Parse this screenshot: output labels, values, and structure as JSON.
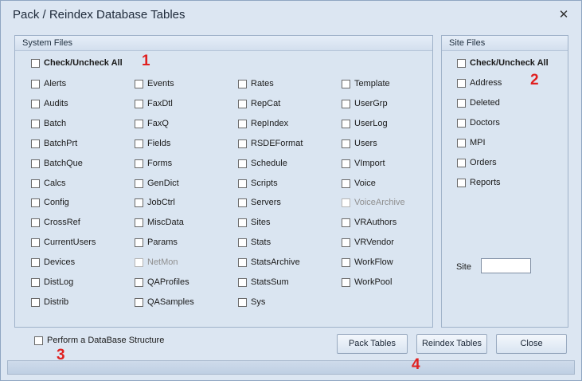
{
  "window": {
    "title": "Pack / Reindex Database Tables",
    "close_glyph": "✕"
  },
  "system_files": {
    "title": "System Files",
    "check_all": "Check/Uncheck All",
    "columns": [
      [
        "Alerts",
        "Audits",
        "Batch",
        "BatchPrt",
        "BatchQue",
        "Calcs",
        "Config",
        "CrossRef",
        "CurrentUsers",
        "Devices",
        "DistLog",
        "Distrib"
      ],
      [
        "Events",
        "FaxDtl",
        "FaxQ",
        "Fields",
        "Forms",
        "GenDict",
        "JobCtrl",
        "MiscData",
        "Params",
        "NetMon",
        "QAProfiles",
        "QASamples"
      ],
      [
        "Rates",
        "RepCat",
        "RepIndex",
        "RSDEFormat",
        "Schedule",
        "Scripts",
        "Servers",
        "Sites",
        "Stats",
        "StatsArchive",
        "StatsSum",
        "Sys"
      ],
      [
        "Template",
        "UserGrp",
        "UserLog",
        "Users",
        "VImport",
        "Voice",
        "VoiceArchive",
        "VRAuthors",
        "VRVendor",
        "WorkFlow",
        "WorkPool"
      ]
    ],
    "disabled": [
      "NetMon",
      "VoiceArchive"
    ]
  },
  "site_files": {
    "title": "Site Files",
    "check_all": "Check/Uncheck All",
    "items": [
      "Address",
      "Deleted",
      "Doctors",
      "MPI",
      "Orders",
      "Reports"
    ],
    "site_label": "Site",
    "site_value": ""
  },
  "structure_option": "Perform a DataBase Structure",
  "buttons": {
    "pack": "Pack Tables",
    "reindex": "Reindex Tables",
    "close": "Close"
  },
  "markers": [
    "1",
    "2",
    "3",
    "4"
  ],
  "colors": {
    "marker": "#e02020"
  }
}
